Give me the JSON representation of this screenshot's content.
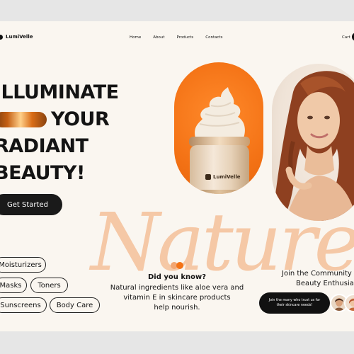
{
  "brand": {
    "name": "LumiVelle"
  },
  "nav": {
    "items": [
      "Home",
      "About",
      "Products",
      "Contacts"
    ],
    "cart": "Cart"
  },
  "hero": {
    "lines": [
      "ILLUMINATE",
      "YOUR",
      "RADIANT",
      "BEAUTY!"
    ],
    "cta": "Get Started",
    "script_word": "Nature"
  },
  "categories": [
    "Moisturizers",
    "Masks",
    "Toners",
    "Sunscreens",
    "Body Care"
  ],
  "product": {
    "jar_label": "LumiVelle"
  },
  "did_you_know": {
    "title": "Did you know?",
    "body": [
      "Natural ingredients like aloe vera and",
      "vitamin E in skincare products",
      "help nourish."
    ]
  },
  "community": {
    "line1": "Join the Community",
    "line2": "Beauty Enthusia",
    "trust_text": [
      "Join the many who trust us for",
      "their skincare needs!"
    ]
  },
  "colors": {
    "accent": "#f47316",
    "dark": "#1a1a1a",
    "background": "#faf6f0",
    "script": "#f5c8a6"
  }
}
